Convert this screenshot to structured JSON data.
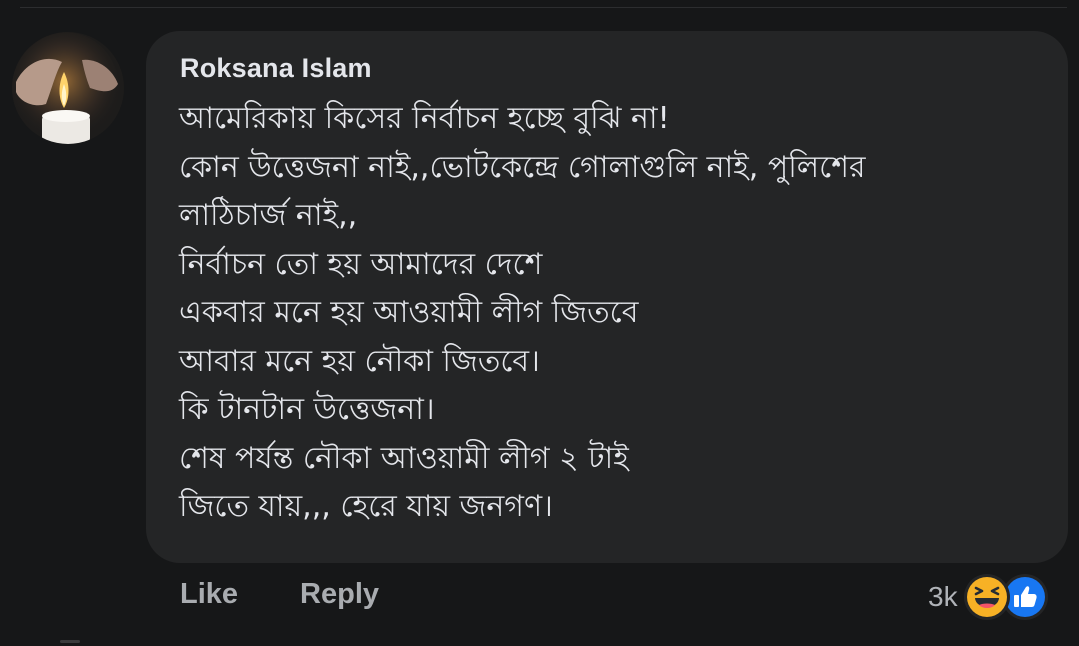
{
  "comment": {
    "author": "Roksana Islam",
    "lines": [
      "আমেরিকায় কিসের নির্বাচন হচ্ছে বুঝি না!",
      "কোন উত্তেজনা নাই,,ভোটকেন্দ্রে গোলাগুলি নাই, পুলিশের",
      "লাঠিচার্জ নাই,,",
      "নির্বাচন তো হয় আমাদের দেশে",
      "একবার মনে হয় আওয়ামী লীগ জিতবে",
      "আবার মনে হয় নৌকা জিতবে।",
      "কি টানটান উত্তেজনা।",
      "শেষ পর্যন্ত নৌকা আওয়ামী লীগ ২ টাই",
      "জিতে যায়,,, হেরে যায় জনগণ।"
    ]
  },
  "actions": {
    "like_label": "Like",
    "reply_label": "Reply"
  },
  "reactions": {
    "count": "3k",
    "icons": [
      "haha-icon",
      "like-icon"
    ]
  },
  "colors": {
    "background": "#161718",
    "bubble": "#242526",
    "text": "#e4e6eb",
    "muted": "#a9acb0",
    "haha_yellow": "#f7b125",
    "like_blue": "#1877f2"
  }
}
